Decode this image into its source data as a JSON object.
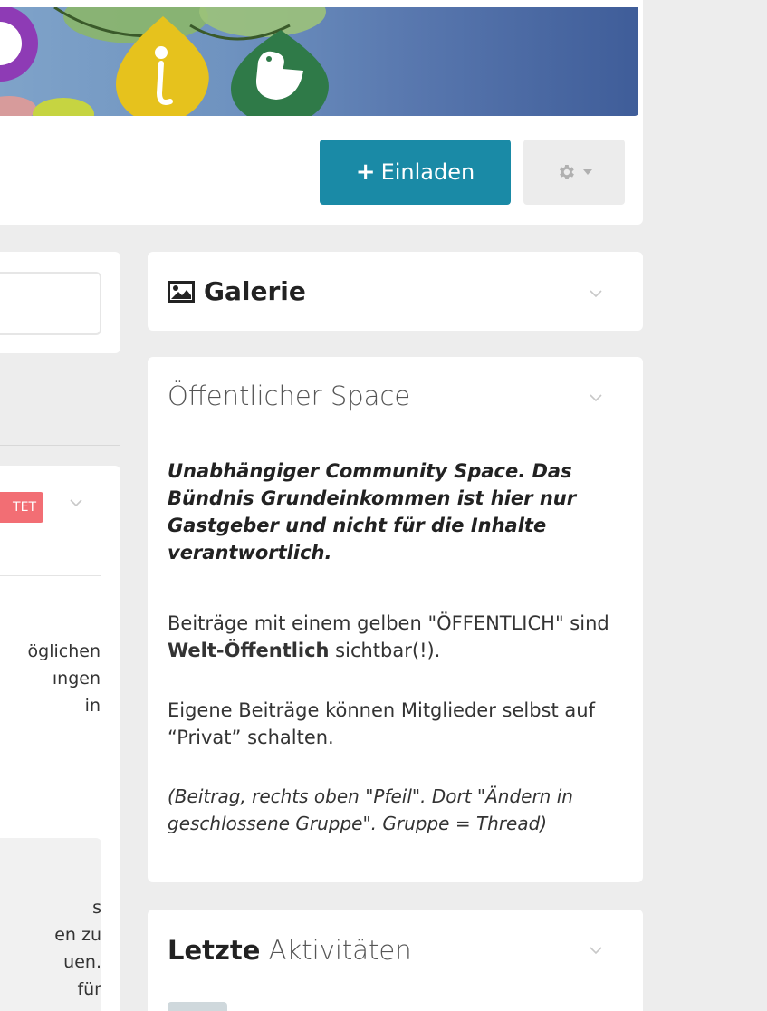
{
  "header": {
    "invite_label": "Einladen",
    "invite_icon": "plus-icon",
    "settings_icon": "gear-icon",
    "accent_color": "#1a8aa6"
  },
  "left_column": {
    "badge_text": "TET",
    "badge_color": "#f26e74",
    "text_lines": [
      "öglichen",
      "ıngen",
      "in"
    ],
    "text_lines_2": [
      "s",
      "en zu",
      "uen.",
      "für"
    ]
  },
  "galerie": {
    "title": "Galerie",
    "icon": "image-icon"
  },
  "space": {
    "title": "Öffentlicher Space",
    "intro": "Unabhängiger Community Space. Das Bündnis Grundeinkommen ist hier nur Gastgeber und nicht für die Inhalte verantwortlich.",
    "para1_before": "Beiträge mit einem gelben \"ÖFFENTLICH\" sind ",
    "para1_bold": "Welt-Öffentlich",
    "para1_after": " sichtbar(!).",
    "para2": "Eigene Beiträge können Mitglieder selbst auf “Privat” schalten.",
    "para3": "(Beitrag, rechts oben \"Pfeil\". Dort \"Ändern in geschlossene Gruppe\". Gruppe = Thread)"
  },
  "activities": {
    "title_bold": "Letzte",
    "title_rest": "Aktivitäten"
  }
}
